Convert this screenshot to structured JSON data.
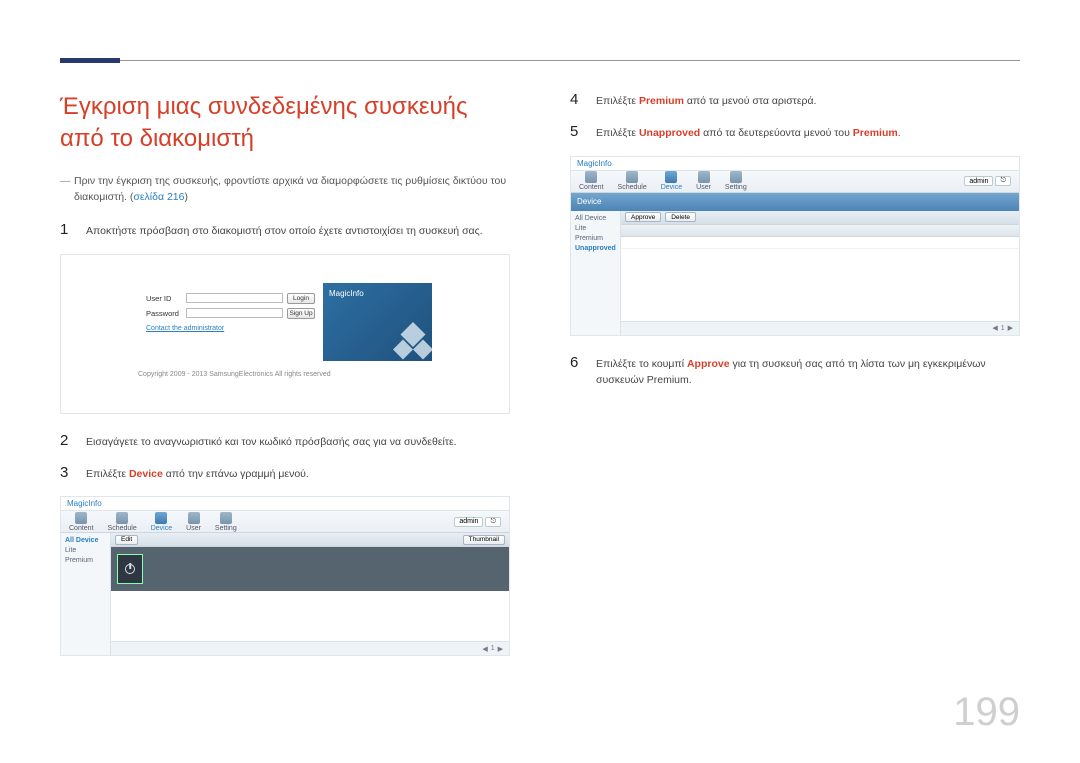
{
  "page_number": "199",
  "heading": "Έγκριση μιας συνδεδεμένης συσκευής από το διακομιστή",
  "note": {
    "dash": "―",
    "text_pre": "Πριν την έγκριση της συσκευής, φροντίστε αρχικά να διαμορφώσετε τις ρυθμίσεις δικτύου του διακομιστή. (",
    "link": "σελίδα 216",
    "text_post": ")"
  },
  "steps": {
    "s1": {
      "num": "1",
      "text": "Αποκτήστε πρόσβαση στο διακομιστή στον οποίο έχετε αντιστοιχίσει τη συσκευή σας."
    },
    "s2": {
      "num": "2",
      "text": "Εισαγάγετε το αναγνωριστικό και τον κωδικό πρόσβασής σας για να συνδεθείτε."
    },
    "s3": {
      "num": "3",
      "pre": "Επιλέξτε ",
      "kw": "Device",
      "post": " από την επάνω γραμμή μενού."
    },
    "s4": {
      "num": "4",
      "pre": "Επιλέξτε ",
      "kw": "Premium",
      "post": " από τα μενού στα αριστερά."
    },
    "s5": {
      "num": "5",
      "pre": "Επιλέξτε ",
      "kw1": "Unapproved",
      "mid": " από τα δευτερεύοντα μενού του ",
      "kw2": "Premium",
      "post": "."
    },
    "s6": {
      "num": "6",
      "pre": "Επιλέξτε το κουμπί ",
      "kw": "Approve",
      "post": " για τη συσκευή σας από τη λίστα των μη εγκεκριμένων συσκευών Premium."
    }
  },
  "login_shot": {
    "user_label": "User ID",
    "pass_label": "Password",
    "login_btn": "Login",
    "signup_btn": "Sign Up",
    "contact": "Contact the administrator",
    "brand": "MagicInfo",
    "copyright": "Copyright 2009 - 2013 SamsungElectronics All rights reserved"
  },
  "srv": {
    "brand": "MagicInfo",
    "tabs": [
      "Content",
      "Schedule",
      "Device",
      "User",
      "Setting"
    ],
    "right_chip": "admin",
    "side_items": [
      "All Device",
      "Lite",
      "Premium",
      "Unapproved"
    ],
    "actions": [
      "Approve",
      "Delete"
    ],
    "action_extra": [
      "Edit",
      "Thumbnail"
    ],
    "bighead": "Device",
    "pager": "1"
  }
}
